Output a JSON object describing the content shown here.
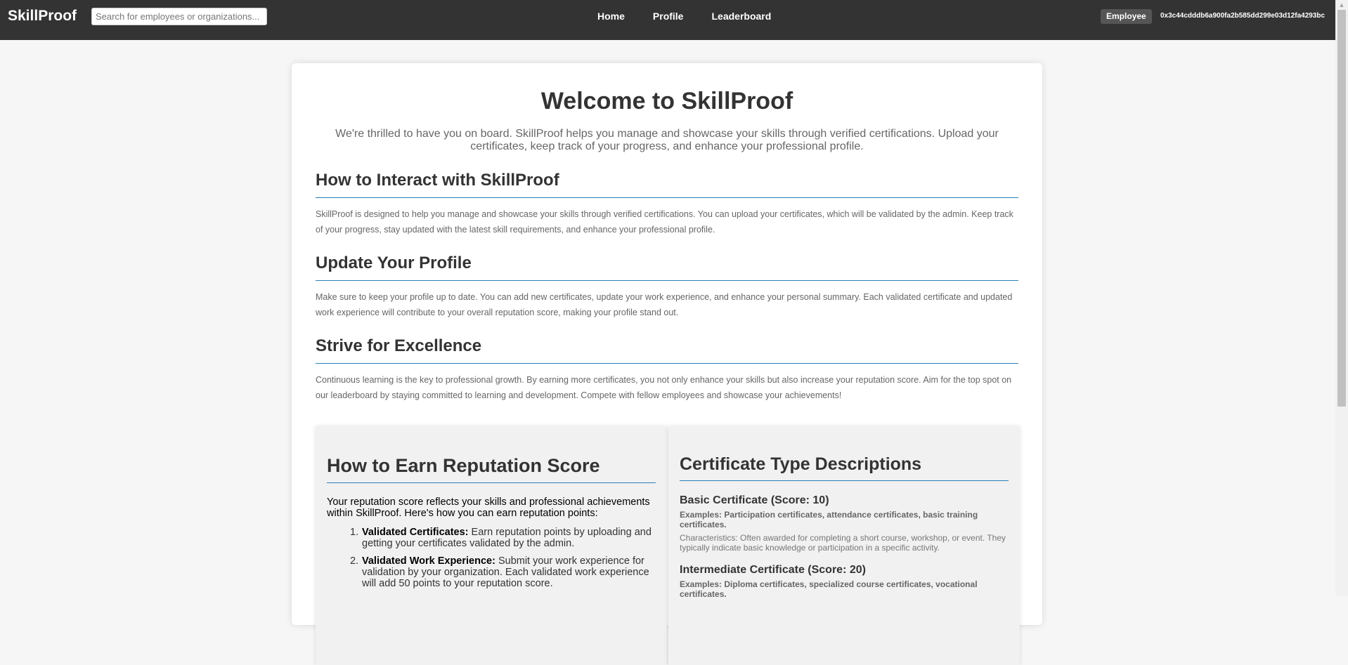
{
  "nav": {
    "brand": "SkillProof",
    "search_placeholder": "Search for employees or organizations...",
    "links": [
      "Home",
      "Profile",
      "Leaderboard"
    ],
    "role": "Employee",
    "wallet_address": "0x3c44cdddb6a900fa2b585dd299e03d12fa4293bc"
  },
  "welcome": {
    "title": "Welcome to SkillProof",
    "text": "We're thrilled to have you on board. SkillProof helps you manage and showcase your skills through verified certifications. Upload your certificates, keep track of your progress, and enhance your professional profile."
  },
  "sections": [
    {
      "heading": "How to Interact with SkillProof",
      "text": "SkillProof is designed to help you manage and showcase your skills through verified certifications. You can upload your certificates, which will be validated by the admin. Keep track of your progress, stay updated with the latest skill requirements, and enhance your professional profile."
    },
    {
      "heading": "Update Your Profile",
      "text": "Make sure to keep your profile up to date. You can add new certificates, update your work experience, and enhance your personal summary. Each validated certificate and updated work experience will contribute to your overall reputation score, making your profile stand out."
    },
    {
      "heading": "Strive for Excellence",
      "text": "Continuous learning is the key to professional growth. By earning more certificates, you not only enhance your skills but also increase your reputation score. Aim for the top spot on our leaderboard by staying committed to learning and development. Compete with fellow employees and showcase your achievements!"
    }
  ],
  "reputation": {
    "title": "How to Earn Reputation Score",
    "intro": "Your reputation score reflects your skills and professional achievements within SkillProof. Here's how you can earn reputation points:",
    "items": [
      {
        "num": "1.",
        "label": "Validated Certificates:",
        "text": "Earn reputation points by uploading and getting your certificates validated by the admin."
      },
      {
        "num": "2.",
        "label": "Validated Work Experience:",
        "text": "Submit your work experience for validation by your organization. Each validated work experience will add 50 points to your reputation score."
      }
    ]
  },
  "certificates": {
    "title": "Certificate Type Descriptions",
    "types": [
      {
        "name": "Basic Certificate (Score: 10)",
        "examples_label": "Examples:",
        "examples": "Participation certificates, attendance certificates, basic training certificates.",
        "characteristics": "Characteristics: Often awarded for completing a short course, workshop, or event. They typically indicate basic knowledge or participation in a specific activity."
      },
      {
        "name": "Intermediate Certificate (Score: 20)",
        "examples_label": "Examples:",
        "examples": "Diploma certificates, specialized course certificates, vocational certificates.",
        "characteristics": ""
      }
    ]
  }
}
